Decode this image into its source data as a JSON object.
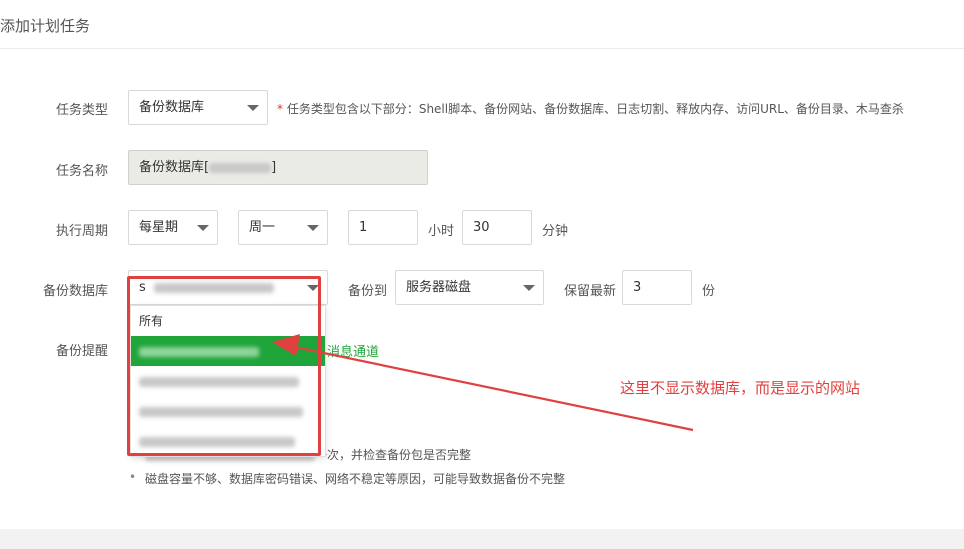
{
  "page": {
    "title": "添加计划任务"
  },
  "form": {
    "task_type": {
      "label": "任务类型",
      "value": "备份数据库",
      "note_star": "*",
      "note": "任务类型包含以下部分：Shell脚本、备份网站、备份数据库、日志切割、释放内存、访问URL、备份目录、木马查杀"
    },
    "task_name": {
      "label": "任务名称",
      "prefix": "备份数据库[",
      "suffix": "]"
    },
    "cycle": {
      "label": "执行周期",
      "period": "每星期",
      "weekday": "周一",
      "hour": "1",
      "hour_unit": "小时",
      "minute": "30",
      "minute_unit": "分钟"
    },
    "backup_db": {
      "label": "备份数据库",
      "value_prefix": "s",
      "backup_to_label": "备份到",
      "backup_to": "服务器磁盘",
      "keep_label": "保留最新",
      "keep_value": "3",
      "keep_unit": "份"
    },
    "reminder": {
      "label": "备份提醒",
      "link": "消息通道"
    },
    "dropdown": {
      "first_option": "所有"
    },
    "tips": [
      "一次，并检查备份包是否完整",
      "磁盘容量不够、数据库密码错误、网络不稳定等原因，可能导致数据备份不完整"
    ]
  },
  "annotation": {
    "text": "这里不显示数据库，而是显示的网站",
    "color": "#e04040"
  },
  "colors": {
    "accent_green": "#20a53a",
    "annotation_red": "#e04040"
  }
}
